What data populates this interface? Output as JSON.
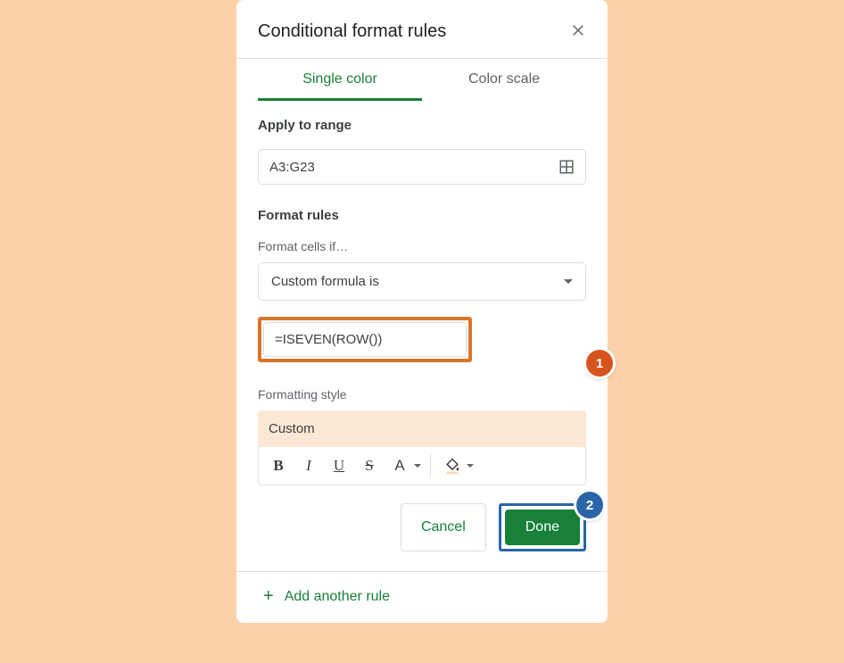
{
  "header": {
    "title": "Conditional format rules"
  },
  "tabs": {
    "single": "Single color",
    "scale": "Color scale"
  },
  "apply": {
    "label": "Apply to range",
    "range": "A3:G23"
  },
  "rules": {
    "label": "Format rules",
    "cells_if": "Format cells if…",
    "condition": "Custom formula is",
    "formula": "=ISEVEN(ROW())"
  },
  "style": {
    "label": "Formatting style",
    "name": "Custom"
  },
  "buttons": {
    "cancel": "Cancel",
    "done": "Done"
  },
  "add_rule": "Add another rule",
  "callouts": {
    "one": "1",
    "two": "2"
  }
}
